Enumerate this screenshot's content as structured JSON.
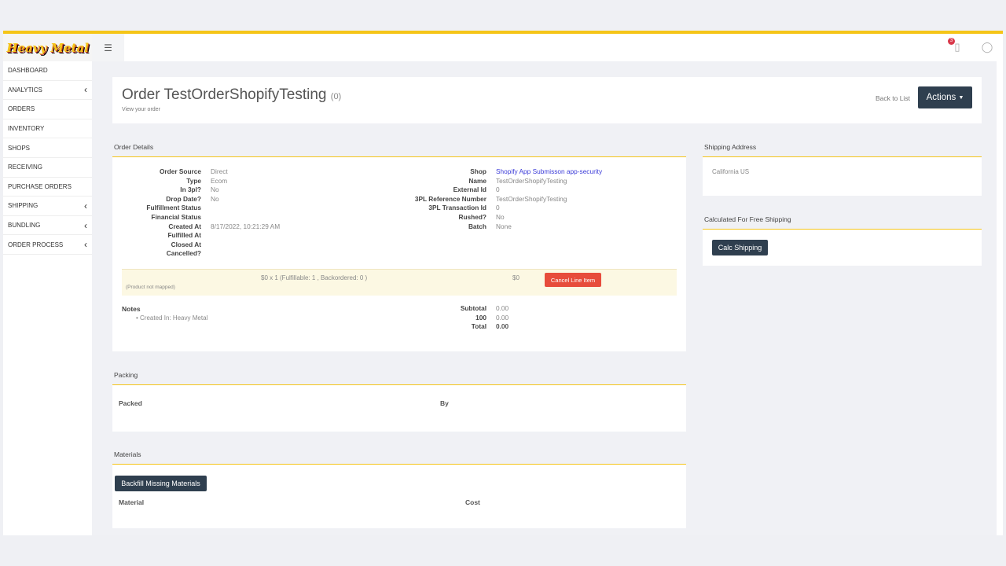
{
  "header": {
    "logo_text": "Heavy Metal",
    "menu_icon": "hamburger-icon",
    "notification_count": "3",
    "notification_icon": "clipboard-icon",
    "user_icon": "user-icon"
  },
  "sidebar": {
    "items": [
      {
        "label": "DASHBOARD",
        "chevron": false
      },
      {
        "label": "ANALYTICS",
        "chevron": true
      },
      {
        "label": "ORDERS",
        "chevron": false
      },
      {
        "label": "INVENTORY",
        "chevron": false
      },
      {
        "label": "SHOPS",
        "chevron": false
      },
      {
        "label": "RECEIVING",
        "chevron": false
      },
      {
        "label": "PURCHASE ORDERS",
        "chevron": false
      },
      {
        "label": "SHIPPING",
        "chevron": true
      },
      {
        "label": "BUNDLING",
        "chevron": true
      },
      {
        "label": "ORDER PROCESS",
        "chevron": true
      }
    ]
  },
  "page": {
    "title": "Order TestOrderShopifyTesting",
    "count": "(0)",
    "subtitle": "View your order",
    "back_label": "Back to List",
    "actions_label": "Actions"
  },
  "order_details": {
    "title": "Order Details",
    "left": [
      {
        "k": "Order Source",
        "v": "Direct"
      },
      {
        "k": "Type",
        "v": "Ecom"
      },
      {
        "k": "In 3pl?",
        "v": "No"
      },
      {
        "k": "Drop Date?",
        "v": "No"
      },
      {
        "k": "Fulfillment Status",
        "v": ""
      },
      {
        "k": "Financial Status",
        "v": ""
      },
      {
        "k": "Created At",
        "v": "8/17/2022, 10:21:29 AM"
      },
      {
        "k": "Fulfilled At",
        "v": ""
      },
      {
        "k": "Closed At",
        "v": ""
      },
      {
        "k": "Cancelled?",
        "v": ""
      }
    ],
    "right": [
      {
        "k": "Shop",
        "v": "Shopify App Submisson app-security"
      },
      {
        "k": "Name",
        "v": "TestOrderShopifyTesting"
      },
      {
        "k": "External Id",
        "v": "0"
      },
      {
        "k": "3PL Reference Number",
        "v": "TestOrderShopifyTesting"
      },
      {
        "k": "3PL Transaction Id",
        "v": "0"
      },
      {
        "k": "Rushed?",
        "v": "No"
      },
      {
        "k": "Batch",
        "v": "None"
      }
    ],
    "line_item": {
      "qty": "$0 x 1 (Fulfillable: 1 , Backordered: 0 )",
      "note": "(Product not mapped)",
      "price": "$0",
      "cancel_label": "Cancel Line Item"
    },
    "notes_title": "Notes",
    "notes": [
      "Created In: Heavy Metal"
    ],
    "totals": [
      {
        "k": "Subtotal",
        "v": "0.00"
      },
      {
        "k": "100",
        "v": "0.00"
      },
      {
        "k": "Total",
        "v": "0.00"
      }
    ]
  },
  "packing": {
    "title": "Packing",
    "col1": "Packed",
    "col2": "By"
  },
  "materials": {
    "title": "Materials",
    "backfill_label": "Backfill Missing Materials",
    "col1": "Material",
    "col2": "Cost"
  },
  "shipping_address": {
    "title": "Shipping Address",
    "value": "California US"
  },
  "free_shipping": {
    "title": "Calculated For Free Shipping",
    "button_label": "Calc Shipping"
  },
  "colors": {
    "accent": "#f5c518",
    "dark_button": "#2f3f4f",
    "danger": "#e74c3c",
    "link": "#3b3bd8"
  }
}
